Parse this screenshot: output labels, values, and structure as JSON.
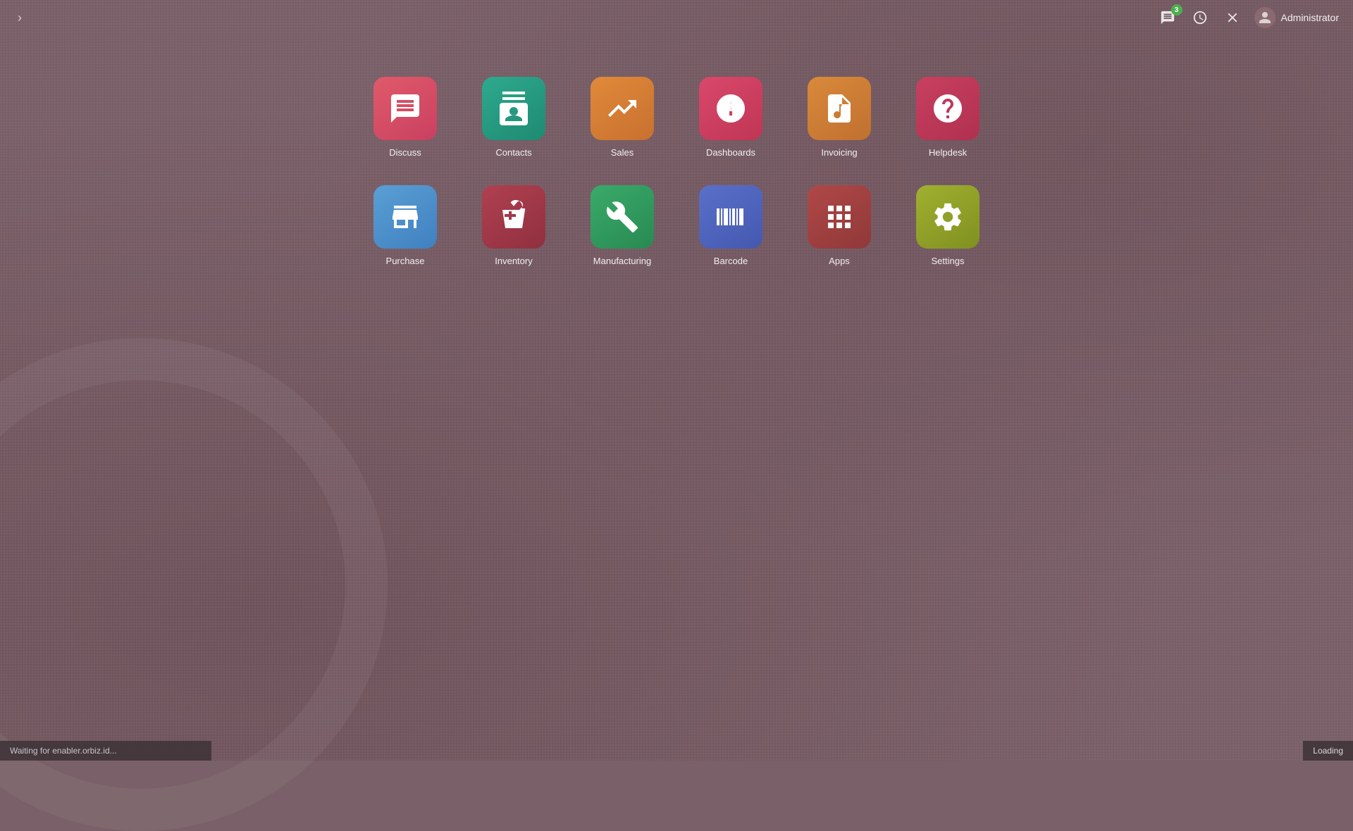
{
  "topbar": {
    "nav_toggle_label": "›",
    "message_icon": "💬",
    "message_badge": "3",
    "clock_icon": "🕐",
    "close_icon": "✕",
    "user_name": "Administrator"
  },
  "apps": {
    "row1": [
      {
        "id": "discuss",
        "label": "Discuss",
        "color_class": "icon-discuss",
        "icon": "discuss"
      },
      {
        "id": "contacts",
        "label": "Contacts",
        "color_class": "icon-contacts",
        "icon": "contacts"
      },
      {
        "id": "sales",
        "label": "Sales",
        "color_class": "icon-sales",
        "icon": "sales"
      },
      {
        "id": "dashboards",
        "label": "Dashboards",
        "color_class": "icon-dashboards",
        "icon": "dashboards"
      },
      {
        "id": "invoicing",
        "label": "Invoicing",
        "color_class": "icon-invoicing",
        "icon": "invoicing"
      },
      {
        "id": "helpdesk",
        "label": "Helpdesk",
        "color_class": "icon-helpdesk",
        "icon": "helpdesk"
      }
    ],
    "row2": [
      {
        "id": "purchase",
        "label": "Purchase",
        "color_class": "icon-purchase",
        "icon": "purchase"
      },
      {
        "id": "inventory",
        "label": "Inventory",
        "color_class": "icon-inventory",
        "icon": "inventory"
      },
      {
        "id": "manufacturing",
        "label": "Manufacturing",
        "color_class": "icon-manufacturing",
        "icon": "manufacturing"
      },
      {
        "id": "barcode",
        "label": "Barcode",
        "color_class": "icon-barcode",
        "icon": "barcode"
      },
      {
        "id": "apps",
        "label": "Apps",
        "color_class": "icon-apps",
        "icon": "apps"
      },
      {
        "id": "settings",
        "label": "Settings",
        "color_class": "icon-settings",
        "icon": "settings"
      }
    ]
  },
  "statusbar": {
    "left_text": "Waiting for enabler.orbiz.id...",
    "right_text": "Loading"
  }
}
